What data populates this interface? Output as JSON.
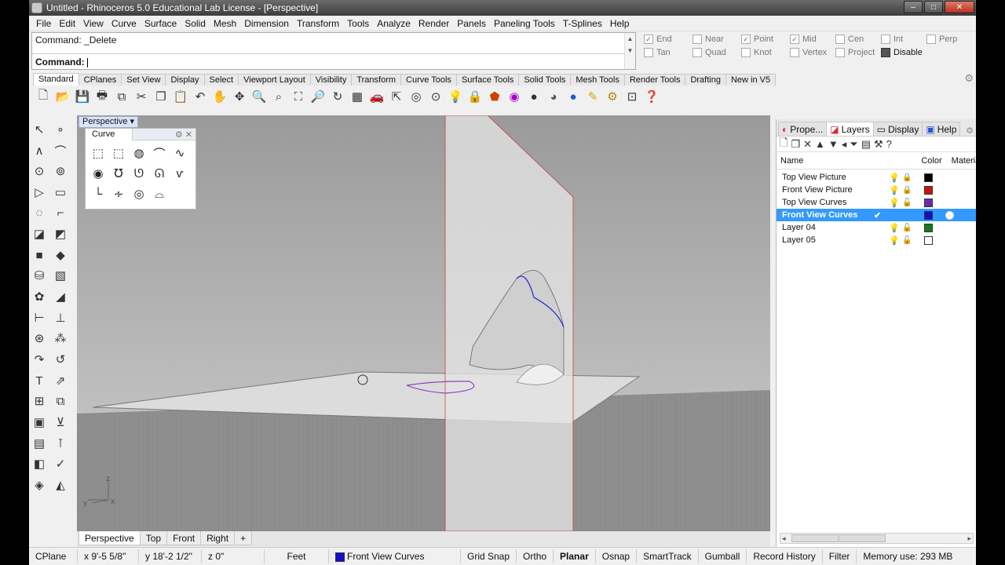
{
  "window": {
    "title": "Untitled - Rhinoceros 5.0 Educational Lab License - [Perspective]",
    "min": "–",
    "max": "□",
    "close": "✕"
  },
  "menu": [
    "File",
    "Edit",
    "View",
    "Curve",
    "Surface",
    "Solid",
    "Mesh",
    "Dimension",
    "Transform",
    "Tools",
    "Analyze",
    "Render",
    "Panels",
    "Paneling Tools",
    "T-Splines",
    "Help"
  ],
  "command": {
    "history": "Command: _Delete",
    "prompt": "Command:",
    "value": ""
  },
  "osnaps": [
    {
      "label": "End",
      "checked": true
    },
    {
      "label": "Near",
      "checked": false
    },
    {
      "label": "Point",
      "checked": true
    },
    {
      "label": "Mid",
      "checked": true
    },
    {
      "label": "Cen",
      "checked": false
    },
    {
      "label": "Int",
      "checked": false
    },
    {
      "label": "Perp",
      "checked": false
    },
    {
      "label": "Tan",
      "checked": false
    },
    {
      "label": "Quad",
      "checked": false
    },
    {
      "label": "Knot",
      "checked": false
    },
    {
      "label": "Vertex",
      "checked": false
    },
    {
      "label": "Project",
      "checked": false
    },
    {
      "label": "Disable",
      "checked": false
    }
  ],
  "toolbar_tabs": [
    "Standard",
    "CPlanes",
    "Set View",
    "Display",
    "Select",
    "Viewport Layout",
    "Visibility",
    "Transform",
    "Curve Tools",
    "Surface Tools",
    "Solid Tools",
    "Mesh Tools",
    "Render Tools",
    "Drafting",
    "New in V5"
  ],
  "toolbar_icons": [
    "new-icon",
    "open-icon",
    "save-icon",
    "print-icon",
    "cut-icon",
    "copy-icon",
    "paste-icon",
    "undo-icon",
    "pan-icon",
    "move-view-icon",
    "zoom-icon",
    "zoom-window-icon",
    "zoom-extents-icon",
    "zoom-selected-icon",
    "rotate-view-icon",
    "grid-icon",
    "car-icon",
    "select-icon",
    "circle-icon",
    "point-icon",
    "light-icon",
    "lock-icon",
    "material-icon",
    "color-icon",
    "sphere-icon",
    "render-icon",
    "shade-icon",
    "lamp-icon",
    "settings-icon",
    "crop-icon",
    "help-icon"
  ],
  "viewport": {
    "name": "Perspective",
    "panel_title": "Curve",
    "axes": {
      "x": "x",
      "y": "y",
      "z": "z"
    }
  },
  "view_tabs": [
    "Perspective",
    "Top",
    "Front",
    "Right",
    "+"
  ],
  "panel_tabs": [
    "Prope...",
    "Layers",
    "Display",
    "Help"
  ],
  "layers": {
    "headers": {
      "name": "Name",
      "color": "Color",
      "material": "Material"
    },
    "rows": [
      {
        "name": "Top View Picture",
        "color": "#000000",
        "locked": true,
        "current": false
      },
      {
        "name": "Front View Picture",
        "color": "#cc1111",
        "locked": true,
        "current": false
      },
      {
        "name": "Top View Curves",
        "color": "#6a2ab0",
        "locked": false,
        "current": false
      },
      {
        "name": "Front View Curves",
        "color": "#1111cc",
        "locked": false,
        "current": true
      },
      {
        "name": "Layer 04",
        "color": "#1a7a1a",
        "locked": false,
        "current": false
      },
      {
        "name": "Layer 05",
        "color": "#ffffff",
        "locked": false,
        "current": false
      }
    ]
  },
  "status": {
    "cplane": "CPlane",
    "x": "x 9'-5 5/8\"",
    "y": "y 18'-2 1/2\"",
    "z": "z 0\"",
    "units": "Feet",
    "layer": "Front View Curves",
    "layer_color": "#1111cc",
    "grid_snap": "Grid Snap",
    "ortho": "Ortho",
    "planar": "Planar",
    "osnap": "Osnap",
    "smarttrack": "SmartTrack",
    "gumball": "Gumball",
    "record_history": "Record History",
    "filter": "Filter",
    "memory": "Memory use: 293 MB"
  }
}
